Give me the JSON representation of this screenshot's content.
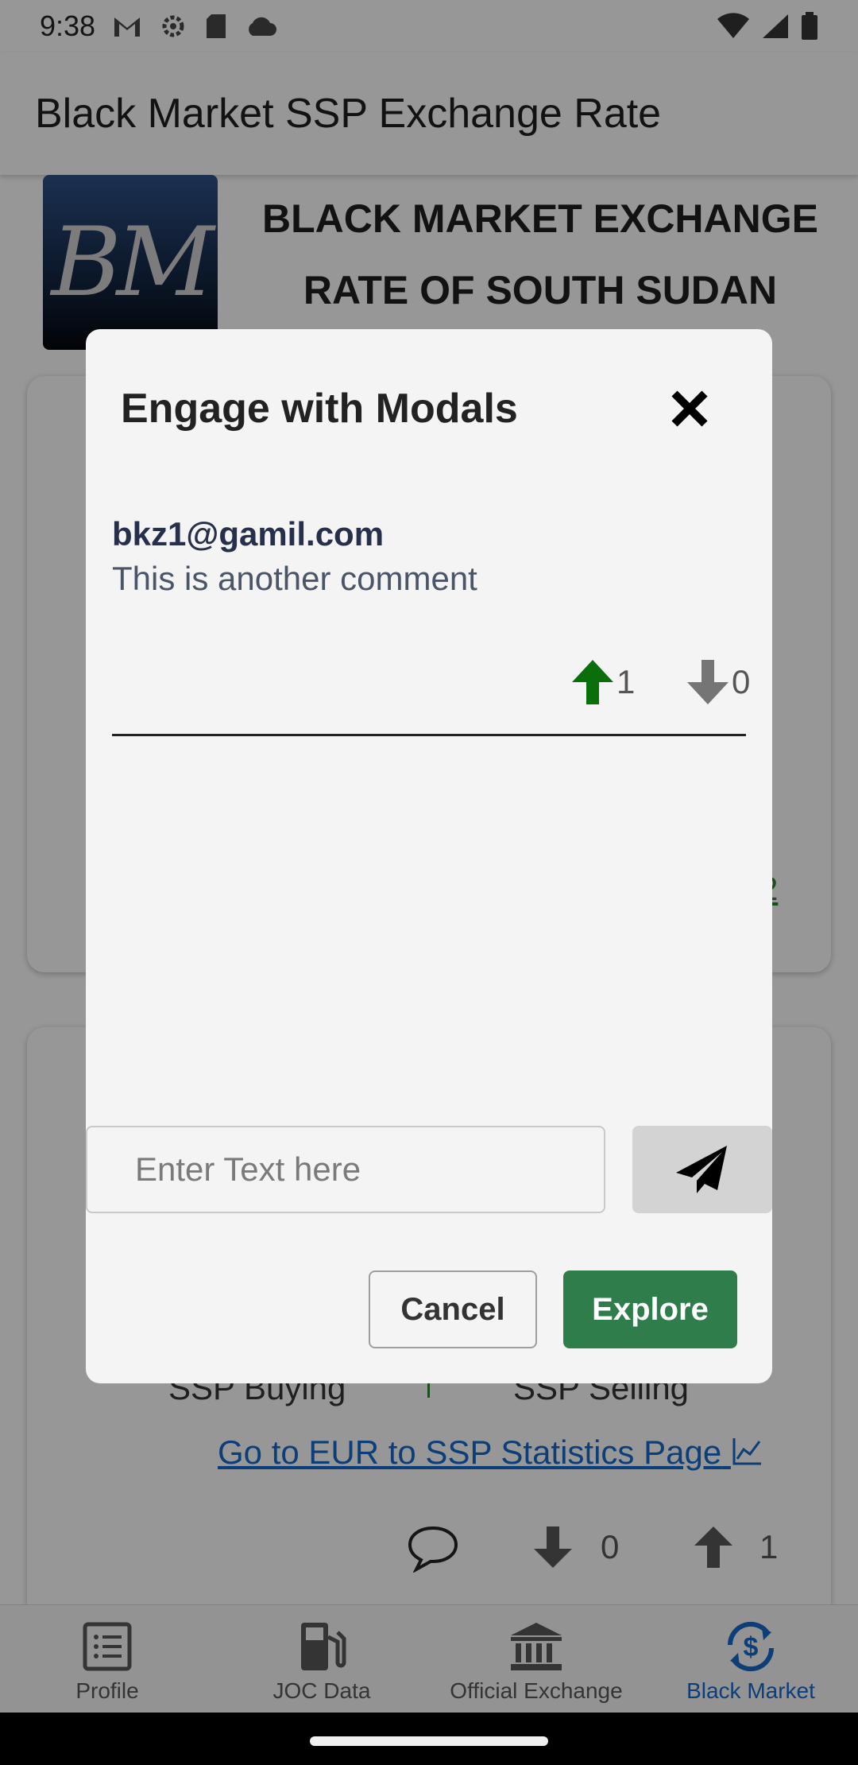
{
  "status_bar": {
    "time": "9:38",
    "left_icons": [
      "gmail-icon",
      "settings-gear-icon",
      "sd-card-icon",
      "cloud-icon"
    ],
    "right_icons": [
      "wifi-icon",
      "signal-icon",
      "battery-icon"
    ]
  },
  "app_bar": {
    "title": "Black Market SSP Exchange Rate"
  },
  "header": {
    "logo_text": "BM",
    "headline": "BLACK MARKET EXCHANGE RATE OF SOUTH SUDAN"
  },
  "card2": {
    "buying_label": "SSP Buying",
    "selling_label": "SSP Selling",
    "stats_link": "Go to EUR to SSP Statistics Page",
    "downvotes": "0",
    "upvotes": "1"
  },
  "bottom_nav": {
    "items": [
      {
        "label": "Profile",
        "icon": "list-icon",
        "active": false
      },
      {
        "label": "JOC Data",
        "icon": "fuel-pump-icon",
        "active": false
      },
      {
        "label": "Official Exchange",
        "icon": "bank-icon",
        "active": false
      },
      {
        "label": "Black Market",
        "icon": "currency-exchange-icon",
        "active": true
      }
    ]
  },
  "modal": {
    "title": "Engage with Modals",
    "comment": {
      "author": "bkz1@gamil.com",
      "text": "This is another comment",
      "upvotes": "1",
      "downvotes": "0"
    },
    "input_placeholder": "Enter Text here",
    "input_value": "",
    "cancel_label": "Cancel",
    "explore_label": "Explore"
  },
  "colors": {
    "upvote_active": "#0a6e0a",
    "vote_inactive": "#757575",
    "explore_button": "#2e7d4a",
    "link": "#1565c0",
    "nav_active": "#1565c0"
  }
}
